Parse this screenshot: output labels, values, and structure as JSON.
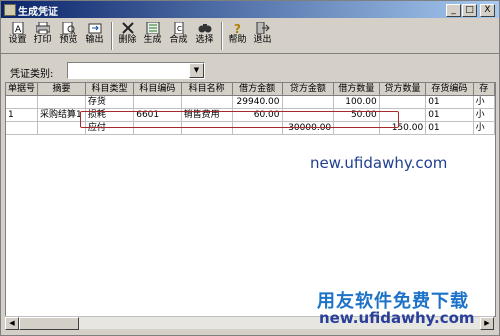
{
  "window": {
    "title": "生成凭证",
    "controls": [
      "_",
      "□",
      "X"
    ]
  },
  "toolbar": {
    "buttons": [
      {
        "label": "设置",
        "icon": "settings-icon"
      },
      {
        "label": "打印",
        "icon": "print-icon"
      },
      {
        "label": "预览",
        "icon": "preview-icon"
      },
      {
        "label": "输出",
        "icon": "export-icon"
      },
      {
        "label": "删除",
        "icon": "delete-icon"
      },
      {
        "label": "生成",
        "icon": "generate-icon"
      },
      {
        "label": "合成",
        "icon": "merge-icon"
      },
      {
        "label": "选择",
        "icon": "select-icon"
      },
      {
        "label": "帮助",
        "icon": "help-icon"
      },
      {
        "label": "退出",
        "icon": "exit-icon"
      }
    ]
  },
  "filter": {
    "label": "凭证类别:",
    "value": ""
  },
  "grid": {
    "columns": [
      "单据号",
      "摘要",
      "科目类型",
      "科目编码",
      "科目名称",
      "借方金额",
      "贷方金额",
      "借方数量",
      "贷方数量",
      "存货编码",
      "存"
    ],
    "rows": [
      [
        "",
        "",
        "存货",
        "",
        "",
        "29940.00",
        "",
        "100.00",
        "",
        "01",
        "小"
      ],
      [
        "1",
        "采购结算1",
        "损耗",
        "6601",
        "销售费用",
        "60.00",
        "",
        "50.00",
        "",
        "01",
        "小"
      ],
      [
        "",
        "",
        "应付",
        "",
        "",
        "",
        "30000.00",
        "",
        "150.00",
        "01",
        "小"
      ]
    ]
  },
  "watermark": {
    "url": "new.ufidawhy.com",
    "logo_text": "用友软件免费下载",
    "logo_url": "new.ufidawhy.com"
  }
}
